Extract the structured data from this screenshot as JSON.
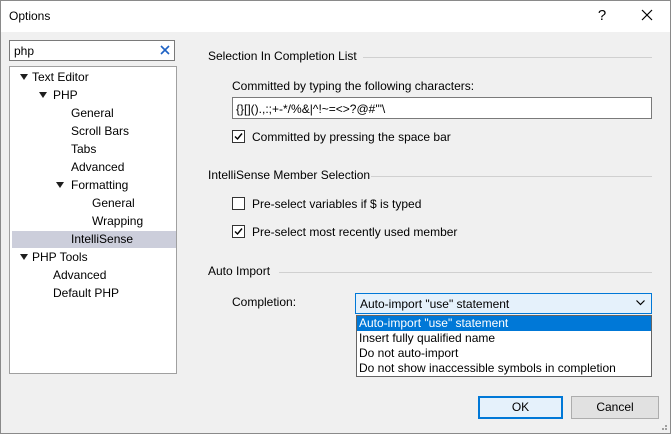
{
  "window": {
    "title": "Options",
    "help_glyph": "?"
  },
  "search": {
    "value": "php"
  },
  "tree": {
    "items": [
      {
        "label": "Text Editor",
        "indent": 0,
        "expanded": true
      },
      {
        "label": "PHP",
        "indent": 1,
        "expanded": true
      },
      {
        "label": "General",
        "indent": 2
      },
      {
        "label": "Scroll Bars",
        "indent": 2
      },
      {
        "label": "Tabs",
        "indent": 2
      },
      {
        "label": "Advanced",
        "indent": 2
      },
      {
        "label": "Formatting",
        "indent": 2,
        "expanded": true
      },
      {
        "label": "General",
        "indent": 3
      },
      {
        "label": "Wrapping",
        "indent": 3
      },
      {
        "label": "IntelliSense",
        "indent": 2,
        "selected": true
      },
      {
        "label": "PHP Tools",
        "indent": 0,
        "expanded": true
      },
      {
        "label": "Advanced",
        "indent": 1
      },
      {
        "label": "Default PHP",
        "indent": 1
      }
    ]
  },
  "completion_list": {
    "title": "Selection In Completion List",
    "committed_chars_label": "Committed by typing the following characters:",
    "committed_chars_value": "{}[]().,:;+-*/%&|^!~=<>?@#'\"\\",
    "space_bar_label": "Committed by pressing the space bar",
    "space_bar_checked": true
  },
  "member_selection": {
    "title": "IntelliSense Member Selection",
    "preselect_vars_label": "Pre-select variables if $ is typed",
    "preselect_vars_checked": false,
    "preselect_recent_label": "Pre-select most recently used member",
    "preselect_recent_checked": true
  },
  "auto_import": {
    "title": "Auto Import",
    "completion_label": "Completion:",
    "selected": "Auto-import \"use\" statement",
    "options": [
      "Auto-import \"use\" statement",
      "Insert fully qualified name",
      "Do not auto-import",
      "Do not show inaccessible symbols in completion"
    ]
  },
  "buttons": {
    "ok": "OK",
    "cancel": "Cancel"
  },
  "colors": {
    "accent": "#0078d7",
    "selection": "#cccedb"
  }
}
